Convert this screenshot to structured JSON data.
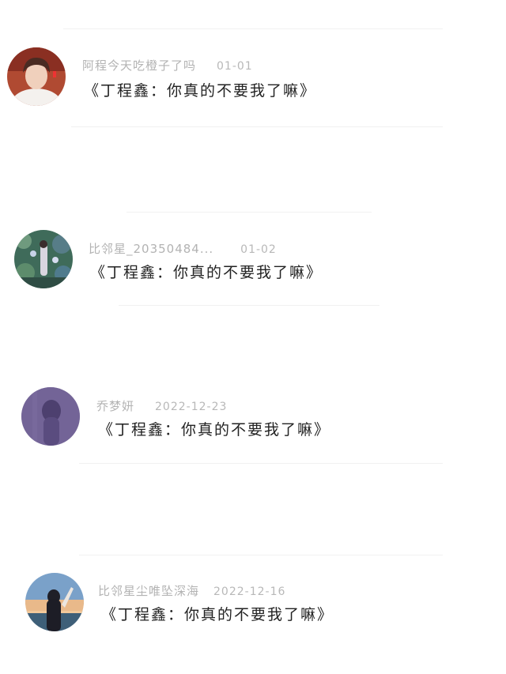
{
  "comments": [
    {
      "username": "阿程今天吃橙子了吗",
      "date": "01-01",
      "text": "《丁程鑫：你真的不要我了嘛》",
      "avatar_icon": "user-avatar-boy"
    },
    {
      "username": "比邻星_20350484...",
      "date": "01-02",
      "text": "《丁程鑫：你真的不要我了嘛》",
      "avatar_icon": "user-avatar-garden-girl"
    },
    {
      "username": "乔梦妍",
      "date": "2022-12-23",
      "text": "《丁程鑫：你真的不要我了嘛》",
      "avatar_icon": "user-avatar-purple"
    },
    {
      "username": "比邻星尘唯坠深海",
      "date": "2022-12-16",
      "text": "《丁程鑫：你真的不要我了嘛》",
      "avatar_icon": "user-avatar-sunset"
    }
  ]
}
